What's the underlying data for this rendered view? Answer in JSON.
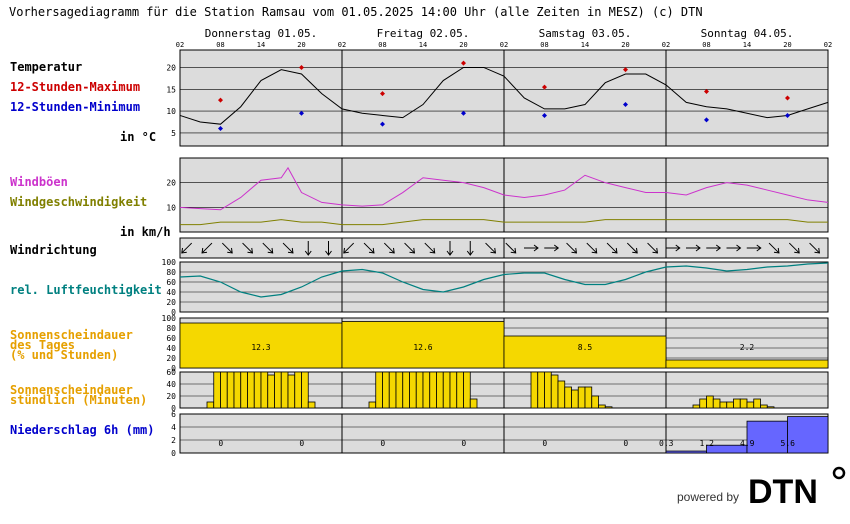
{
  "title": "Vorhersagediagramm für die Station Ramsau vom 01.05.2025 14:00 Uhr (alle Zeiten in MESZ)   (c) DTN",
  "days": [
    "Donnerstag 01.05.",
    "Freitag 02.05.",
    "Samstag 03.05.",
    "Sonntag 04.05."
  ],
  "hour_ticks": [
    "02",
    "08",
    "14",
    "20",
    "02",
    "08",
    "14",
    "20",
    "02",
    "08",
    "14",
    "20",
    "02",
    "08",
    "14",
    "20",
    "02"
  ],
  "labels": {
    "temperature": "Temperatur",
    "max12": "12-Stunden-Maximum",
    "min12": "12-Stunden-Minimum",
    "temp_unit": "in °C",
    "gusts": "Windböen",
    "windspeed": "Windgeschwindigkeit",
    "wind_unit": "in km/h",
    "winddir": "Windrichtung",
    "humidity": "rel. Luftfeuchtigkeit",
    "sun_daily_1": "Sonnenscheindauer",
    "sun_daily_2": "des Tages",
    "sun_daily_3": "(% und Stunden)",
    "sun_hourly_1": "Sonnenscheindauer",
    "sun_hourly_2": "stündlich (Minuten)",
    "precip": "Niederschlag 6h (mm)"
  },
  "colors": {
    "grid_bg": "#dcdcdc",
    "temp": "#000000",
    "max": "#cc0000",
    "min": "#0000cc",
    "gust": "#cc33cc",
    "wind": "#808000",
    "humidity": "#008080",
    "sun_label": "#e6a000",
    "sun_fill": "#f5d800",
    "precip_label": "#0000cc",
    "precip_fill": "#6666ff"
  },
  "footer": {
    "powered_by": "powered by",
    "logo": "DTN"
  },
  "chart_data": [
    {
      "type": "line",
      "name": "temperature",
      "x_hours": [
        0,
        3,
        6,
        9,
        12,
        15,
        18,
        21,
        24,
        27,
        30,
        33,
        36,
        39,
        42,
        45,
        48,
        51,
        54,
        57,
        60,
        63,
        66,
        69,
        72,
        75,
        78,
        81,
        84,
        87,
        90,
        93,
        96
      ],
      "values": [
        9,
        7.5,
        7,
        11,
        17,
        19.5,
        18.5,
        14,
        10.5,
        9.5,
        9,
        8.5,
        11.5,
        17,
        20,
        20,
        18,
        13,
        10.5,
        10.5,
        11.5,
        16.5,
        18.5,
        18.5,
        16,
        12,
        11,
        10.5,
        9.5,
        8.5,
        9,
        10.5,
        12
      ],
      "y_ticks": [
        5,
        10,
        15,
        20
      ],
      "ylim": [
        2,
        24
      ]
    },
    {
      "type": "scatter",
      "name": "12h-max",
      "x_hours": [
        6,
        18,
        30,
        42,
        54,
        66,
        78,
        90
      ],
      "values": [
        12.5,
        20,
        14,
        21,
        15.5,
        19.5,
        14.5,
        13
      ]
    },
    {
      "type": "scatter",
      "name": "12h-min",
      "x_hours": [
        6,
        18,
        30,
        42,
        54,
        66,
        78,
        90
      ],
      "values": [
        6,
        9.5,
        7,
        9.5,
        9,
        11.5,
        8,
        9
      ]
    },
    {
      "type": "line",
      "name": "gusts",
      "x_hours": [
        0,
        3,
        6,
        9,
        12,
        15,
        16,
        18,
        21,
        24,
        27,
        30,
        33,
        36,
        39,
        42,
        45,
        48,
        51,
        54,
        57,
        60,
        63,
        66,
        69,
        72,
        75,
        78,
        81,
        84,
        87,
        90,
        93,
        96
      ],
      "values": [
        10,
        9.5,
        9,
        14,
        21,
        22,
        26,
        16,
        12,
        11,
        10.5,
        11,
        16,
        22,
        21,
        20,
        18,
        15,
        14,
        15,
        17,
        23,
        20,
        18,
        16,
        16,
        15,
        18,
        20,
        19,
        17,
        15,
        13,
        12
      ],
      "y_ticks": [
        10,
        20
      ],
      "ylim": [
        0,
        30
      ]
    },
    {
      "type": "line",
      "name": "windspeed",
      "x_hours": [
        0,
        3,
        6,
        9,
        12,
        15,
        18,
        21,
        24,
        27,
        30,
        33,
        36,
        39,
        42,
        45,
        48,
        51,
        54,
        57,
        60,
        63,
        66,
        69,
        72,
        75,
        78,
        81,
        84,
        87,
        90,
        93,
        96
      ],
      "values": [
        3,
        3,
        4,
        4,
        4,
        5,
        4,
        4,
        3,
        3,
        3,
        4,
        5,
        5,
        5,
        5,
        4,
        4,
        4,
        4,
        4,
        5,
        5,
        5,
        5,
        5,
        5,
        5,
        5,
        5,
        5,
        4,
        4
      ]
    },
    {
      "type": "line",
      "name": "wind-direction",
      "x_hours": [
        1,
        4,
        7,
        10,
        13,
        16,
        19,
        22,
        25,
        28,
        31,
        34,
        37,
        40,
        43,
        46,
        49,
        52,
        55,
        58,
        61,
        64,
        67,
        70,
        73,
        76,
        79,
        82,
        85,
        88,
        91,
        94
      ],
      "values_deg": [
        45,
        45,
        315,
        315,
        315,
        315,
        0,
        0,
        45,
        315,
        315,
        315,
        315,
        0,
        0,
        315,
        315,
        270,
        270,
        315,
        315,
        315,
        315,
        315,
        270,
        270,
        270,
        270,
        270,
        315,
        315,
        315
      ]
    },
    {
      "type": "area",
      "name": "humidity",
      "x_hours": [
        0,
        3,
        6,
        9,
        12,
        15,
        18,
        21,
        24,
        27,
        30,
        33,
        36,
        39,
        42,
        45,
        48,
        51,
        54,
        57,
        60,
        63,
        66,
        69,
        72,
        75,
        78,
        81,
        84,
        87,
        90,
        93,
        96
      ],
      "values": [
        70,
        72,
        60,
        40,
        30,
        35,
        50,
        70,
        82,
        85,
        78,
        60,
        45,
        40,
        50,
        65,
        75,
        78,
        78,
        65,
        55,
        55,
        65,
        80,
        90,
        92,
        88,
        82,
        85,
        90,
        92,
        96,
        98
      ],
      "y_ticks": [
        0,
        20,
        40,
        60,
        80,
        100
      ],
      "ylim": [
        0,
        100
      ]
    },
    {
      "type": "bar",
      "name": "sunshine-daily",
      "categories": [
        "01.05.",
        "02.05.",
        "03.05.",
        "04.05."
      ],
      "percent": [
        90,
        93,
        64,
        16
      ],
      "hours": [
        "12.3",
        "12.6",
        "8.5",
        "2.2"
      ],
      "y_ticks": [
        0,
        20,
        40,
        60,
        80,
        100
      ],
      "ylim": [
        0,
        100
      ]
    },
    {
      "type": "bar",
      "name": "sunshine-hourly",
      "x_hours": [
        4,
        5,
        6,
        7,
        8,
        9,
        10,
        11,
        12,
        13,
        14,
        15,
        16,
        17,
        18,
        19,
        28,
        29,
        30,
        31,
        32,
        33,
        34,
        35,
        36,
        37,
        38,
        39,
        40,
        41,
        42,
        43,
        52,
        53,
        54,
        55,
        56,
        57,
        58,
        59,
        60,
        61,
        62,
        63,
        76,
        77,
        78,
        79,
        80,
        81,
        82,
        83,
        84,
        85,
        86,
        87
      ],
      "values": [
        10,
        60,
        60,
        60,
        60,
        60,
        60,
        60,
        60,
        55,
        60,
        60,
        55,
        60,
        60,
        10,
        10,
        60,
        60,
        60,
        60,
        60,
        60,
        60,
        60,
        60,
        60,
        60,
        60,
        60,
        60,
        15,
        60,
        60,
        60,
        55,
        45,
        35,
        30,
        35,
        35,
        20,
        5,
        2,
        5,
        15,
        20,
        15,
        10,
        10,
        15,
        15,
        10,
        15,
        5,
        2
      ],
      "y_ticks": [
        0,
        20,
        40,
        60
      ],
      "ylim": [
        0,
        60
      ]
    },
    {
      "type": "bar",
      "name": "precipitation-6h",
      "x_hours": [
        0,
        6,
        12,
        18,
        24,
        30,
        36,
        42,
        48,
        54,
        60,
        66,
        72,
        78,
        84,
        90
      ],
      "values": [
        0,
        0,
        0,
        0,
        0,
        0,
        0,
        0,
        0,
        0,
        0,
        0,
        0.3,
        1.2,
        4.9,
        5.6
      ],
      "labels": [
        "",
        "0",
        "",
        "0",
        "",
        "0",
        "",
        "0",
        "",
        "0",
        "",
        "0",
        "0.3",
        "1.2",
        "4.9",
        "5.6"
      ],
      "y_ticks": [
        0,
        2,
        4,
        6
      ],
      "ylim": [
        0,
        6
      ]
    }
  ]
}
